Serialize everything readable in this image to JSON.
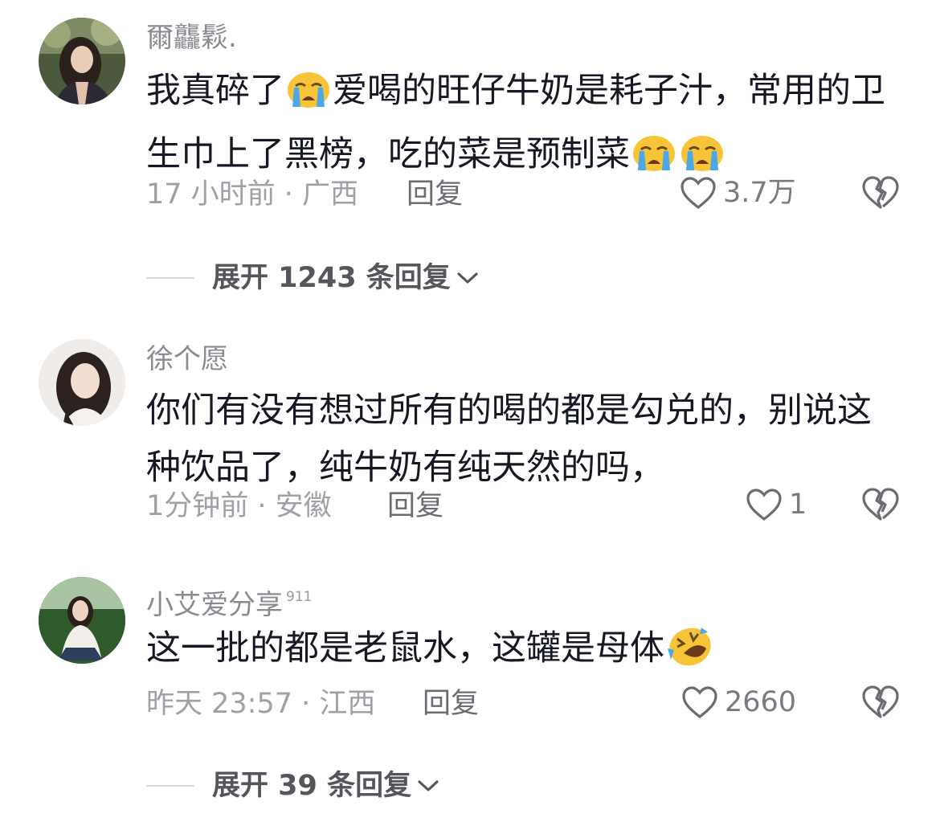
{
  "comments": [
    {
      "username": "爾龘鬏.",
      "badge": "",
      "text_parts": [
        "我真碎了",
        "爱喝的旺仔牛奶是耗子汁，常用的卫生巾上了黑榜，吃的菜是预制菜"
      ],
      "time_location": "17 小时前 · 广西",
      "reply_label": "回复",
      "likes": "3.7万",
      "expand_label": "展开 1243 条回复"
    },
    {
      "username": "徐个愿",
      "badge": "",
      "text_parts": [
        "你们有没有想过所有的喝的都是勾兑的，别说这种饮品了，纯牛奶有纯天然的吗，"
      ],
      "time_location": "1分钟前 · 安徽",
      "reply_label": "回复",
      "likes": "1"
    },
    {
      "username": "小艾爱分享",
      "badge": "911",
      "text_parts": [
        "这一批的都是老鼠水，这罐是母体"
      ],
      "time_location": "昨天 23:57 · 江西",
      "reply_label": "回复",
      "likes": "2660",
      "expand_label": "展开 39 条回复"
    }
  ],
  "icons": {
    "like": "heart-outline-icon",
    "dislike": "broken-heart-icon",
    "expand": "chevron-down-icon",
    "crying_emoji": "loudly-crying-face",
    "laughing_emoji": "rolling-on-floor-laughing-face"
  },
  "colors": {
    "primary_text": "#161823",
    "secondary_text": "#8a8b91",
    "emoji_yellow": "#f7c437",
    "tear_blue": "#4aa8e8"
  }
}
